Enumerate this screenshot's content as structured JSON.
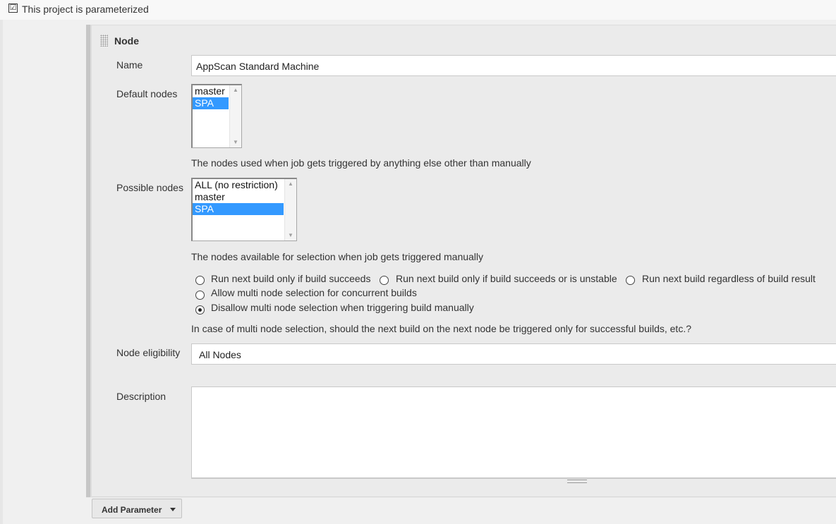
{
  "parameterized": {
    "checked": true,
    "label": "This project is parameterized"
  },
  "parameter": {
    "title": "Node",
    "name": {
      "label": "Name",
      "value": "AppScan Standard Machine"
    },
    "default_nodes": {
      "label": "Default nodes",
      "options": [
        {
          "label": "master",
          "selected": false
        },
        {
          "label": "SPA",
          "selected": true
        }
      ],
      "help": "The nodes used when job gets triggered by anything else other than manually"
    },
    "possible_nodes": {
      "label": "Possible nodes",
      "options": [
        {
          "label": "ALL (no restriction)",
          "selected": false
        },
        {
          "label": "master",
          "selected": false
        },
        {
          "label": "SPA",
          "selected": true
        }
      ],
      "help": "The nodes available for selection when job gets triggered manually"
    },
    "trigger_options": [
      {
        "label": "Run next build only if build succeeds",
        "selected": false
      },
      {
        "label": "Run next build only if build succeeds or is unstable",
        "selected": false
      },
      {
        "label": "Run next build regardless of build result",
        "selected": false
      },
      {
        "label": "Allow multi node selection for concurrent builds",
        "selected": false
      },
      {
        "label": "Disallow multi node selection when triggering build manually",
        "selected": true
      }
    ],
    "trigger_help": "In case of multi node selection, should the next build on the next node be triggered only for successful builds, etc.?",
    "node_eligibility": {
      "label": "Node eligibility",
      "value": "All Nodes"
    },
    "description": {
      "label": "Description",
      "value": ""
    }
  },
  "add_parameter": {
    "label": "Add Parameter"
  },
  "colors": {
    "selection": "#3399ff",
    "panel": "#ebebeb"
  }
}
